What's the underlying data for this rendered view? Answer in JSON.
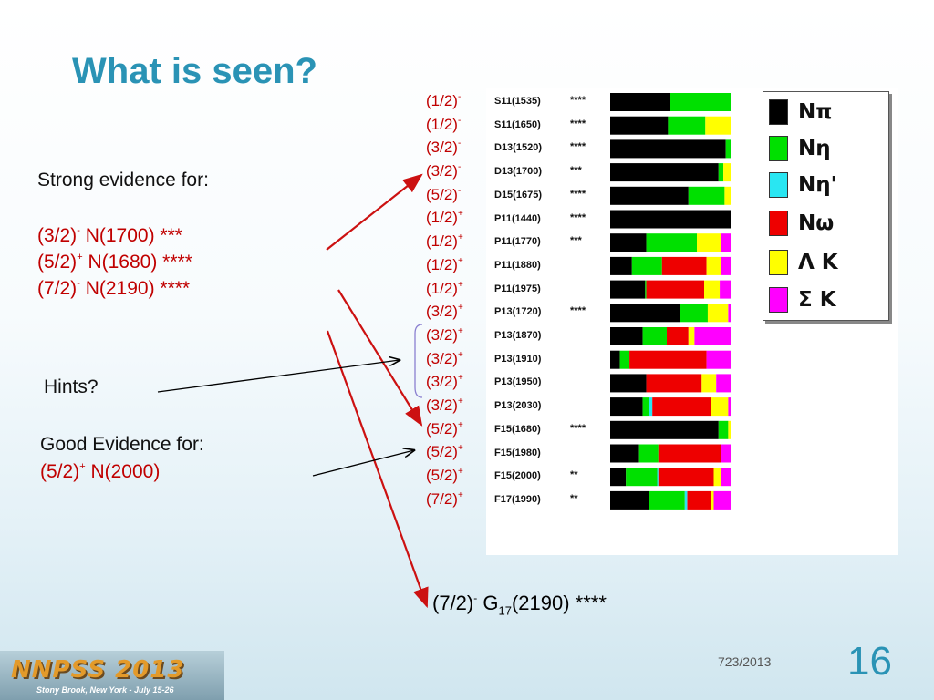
{
  "title": "What is seen?",
  "strong": {
    "heading": "Strong evidence for:",
    "items": [
      {
        "jp": "(3/2)",
        "parity": "-",
        "state": "N(1700) ***"
      },
      {
        "jp": "(5/2)",
        "parity": "+",
        "state": "N(1680) ****"
      },
      {
        "jp": "(7/2)",
        "parity": "-",
        "state": "N(2190) ****"
      }
    ]
  },
  "hints": "Hints?",
  "good": {
    "heading": "Good Evidence for:",
    "jp": "(5/2)",
    "parity": "+",
    "state": "N(2000)"
  },
  "g17": {
    "jp": "(7/2)",
    "parity": "-",
    "g": "G",
    "sub": "17",
    "rest": "(2190) ****"
  },
  "legend": [
    {
      "label": "Nπ",
      "color": "#000000"
    },
    {
      "label": "Nη",
      "color": "#00e000"
    },
    {
      "label": "Nη'",
      "color": "#29e6f2"
    },
    {
      "label": "Nω",
      "color": "#ee0000"
    },
    {
      "label": "Λ K",
      "color": "#ffff00"
    },
    {
      "label": "Σ K",
      "color": "#ff00ff"
    }
  ],
  "chart_data": {
    "type": "bar",
    "stacked": true,
    "orientation": "horizontal",
    "series_order": [
      "Nπ",
      "Nη",
      "Nη'",
      "Nω",
      "Λ K",
      "Σ K"
    ],
    "rows": [
      {
        "jp": "(1/2)",
        "p": "-",
        "name": "S11(1535)",
        "stars": "****",
        "values": [
          0.5,
          0.5,
          0,
          0,
          0,
          0
        ]
      },
      {
        "jp": "(1/2)",
        "p": "-",
        "name": "S11(1650)",
        "stars": "****",
        "values": [
          0.48,
          0.31,
          0,
          0,
          0.21,
          0
        ]
      },
      {
        "jp": "(3/2)",
        "p": "-",
        "name": "D13(1520)",
        "stars": "****",
        "values": [
          0.96,
          0.04,
          0,
          0,
          0,
          0
        ]
      },
      {
        "jp": "(3/2)",
        "p": "-",
        "name": "D13(1700)",
        "stars": "***",
        "values": [
          0.9,
          0.04,
          0,
          0,
          0.06,
          0
        ]
      },
      {
        "jp": "(5/2)",
        "p": "-",
        "name": "D15(1675)",
        "stars": "****",
        "values": [
          0.65,
          0.3,
          0,
          0,
          0.05,
          0
        ]
      },
      {
        "jp": "(1/2)",
        "p": "+",
        "name": "P11(1440)",
        "stars": "****",
        "values": [
          1.0,
          0,
          0,
          0,
          0,
          0
        ]
      },
      {
        "jp": "(1/2)",
        "p": "+",
        "name": "P11(1770)",
        "stars": "***",
        "values": [
          0.3,
          0.42,
          0,
          0,
          0.2,
          0.08
        ]
      },
      {
        "jp": "(1/2)",
        "p": "+",
        "name": "P11(1880)",
        "stars": "",
        "values": [
          0.18,
          0.25,
          0,
          0.37,
          0.12,
          0.08
        ]
      },
      {
        "jp": "(1/2)",
        "p": "+",
        "name": "P11(1975)",
        "stars": "",
        "values": [
          0.29,
          0.01,
          0,
          0.48,
          0.13,
          0.09
        ]
      },
      {
        "jp": "(3/2)",
        "p": "+",
        "name": "P13(1720)",
        "stars": "****",
        "values": [
          0.58,
          0.23,
          0,
          0,
          0.17,
          0.02
        ]
      },
      {
        "jp": "(3/2)",
        "p": "+",
        "name": "P13(1870)",
        "stars": "",
        "values": [
          0.27,
          0.2,
          0,
          0.18,
          0.05,
          0.3
        ]
      },
      {
        "jp": "(3/2)",
        "p": "+",
        "name": "P13(1910)",
        "stars": "",
        "values": [
          0.08,
          0.08,
          0,
          0.64,
          0,
          0.2
        ]
      },
      {
        "jp": "(3/2)",
        "p": "+",
        "name": "P13(1950)",
        "stars": "",
        "values": [
          0.3,
          0,
          0,
          0.46,
          0.12,
          0.12
        ]
      },
      {
        "jp": "(3/2)",
        "p": "+",
        "name": "P13(2030)",
        "stars": "",
        "values": [
          0.27,
          0.05,
          0.03,
          0.49,
          0.14,
          0.02
        ]
      },
      {
        "jp": "(5/2)",
        "p": "+",
        "name": "F15(1680)",
        "stars": "****",
        "values": [
          0.9,
          0.08,
          0,
          0,
          0.02,
          0
        ]
      },
      {
        "jp": "(5/2)",
        "p": "+",
        "name": "F15(1980)",
        "stars": "",
        "values": [
          0.24,
          0.16,
          0,
          0.52,
          0,
          0.08
        ]
      },
      {
        "jp": "(5/2)",
        "p": "+",
        "name": "F15(2000)",
        "stars": "**",
        "values": [
          0.13,
          0.26,
          0.01,
          0.46,
          0.06,
          0.08
        ]
      },
      {
        "jp": "(7/2)",
        "p": "+",
        "name": "F17(1990)",
        "stars": "**",
        "values": [
          0.32,
          0.3,
          0.02,
          0.2,
          0.02,
          0.14
        ]
      }
    ],
    "xlim": [
      0,
      1
    ]
  },
  "footer": {
    "logo_text": "NNPSS 2013",
    "logo_sub": "Stony Brook, New York - July 15-26",
    "date": "723/2013",
    "page": "16"
  }
}
